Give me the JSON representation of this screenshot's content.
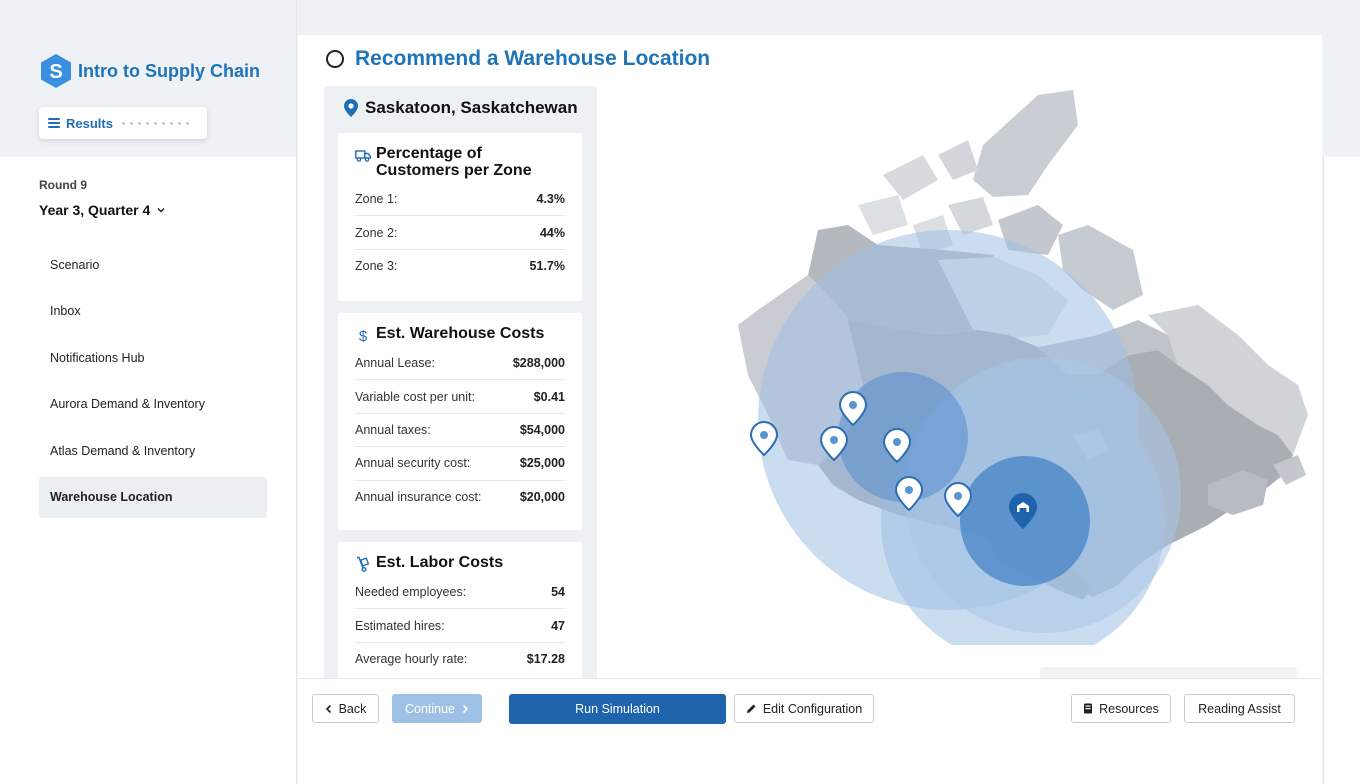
{
  "app": {
    "title": "Intro to Supply Chain"
  },
  "sidebar": {
    "results_label": "Results",
    "round_label": "Round 9",
    "quarter_label": "Year 3, Quarter 4",
    "items": [
      {
        "label": "Scenario"
      },
      {
        "label": "Inbox"
      },
      {
        "label": "Notifications Hub"
      },
      {
        "label": "Aurora Demand & Inventory"
      },
      {
        "label": "Atlas Demand & Inventory"
      },
      {
        "label": "Warehouse Location"
      }
    ],
    "active_item": "Warehouse Location"
  },
  "main": {
    "title": "Recommend a Warehouse Location",
    "location": "Saskatoon, Saskatchewan",
    "customers": {
      "title": "Percentage of Customers per Zone",
      "rows": [
        {
          "label": "Zone 1:",
          "value": "4.3%"
        },
        {
          "label": "Zone 2:",
          "value": "44%"
        },
        {
          "label": "Zone 3:",
          "value": "51.7%"
        }
      ]
    },
    "warehouse_costs": {
      "title": "Est. Warehouse Costs",
      "rows": [
        {
          "label": "Annual Lease:",
          "value": "$288,000"
        },
        {
          "label": "Variable cost per unit:",
          "value": "$0.41"
        },
        {
          "label": "Annual taxes:",
          "value": "$54,000"
        },
        {
          "label": "Annual security cost:",
          "value": "$25,000"
        },
        {
          "label": "Annual insurance cost:",
          "value": "$20,000"
        }
      ]
    },
    "labor_costs": {
      "title": "Est. Labor Costs",
      "rows": [
        {
          "label": "Needed employees:",
          "value": "54"
        },
        {
          "label": "Estimated hires:",
          "value": "47"
        },
        {
          "label": "Average hourly rate:",
          "value": "$17.28"
        }
      ]
    }
  },
  "footer": {
    "back": "Back",
    "continue": "Continue",
    "run": "Run Simulation",
    "edit": "Edit Configuration",
    "resources": "Resources",
    "reading": "Reading Assist"
  },
  "colors": {
    "brand": "#1f74b8",
    "primary_button": "#1f64ad",
    "disabled_button": "#9ec0e4",
    "zone_light": "#c6d8ee",
    "zone_mid": "#8fb3dc",
    "zone_dark": "#3f7fc4"
  },
  "icons": {
    "logo": "s-hexagon-logo",
    "menu": "menu-icon",
    "pin": "map-pin-icon",
    "truck": "truck-icon",
    "dollar": "dollar-icon",
    "dolly": "hand-truck-icon",
    "warehouse": "warehouse-marker-icon"
  }
}
